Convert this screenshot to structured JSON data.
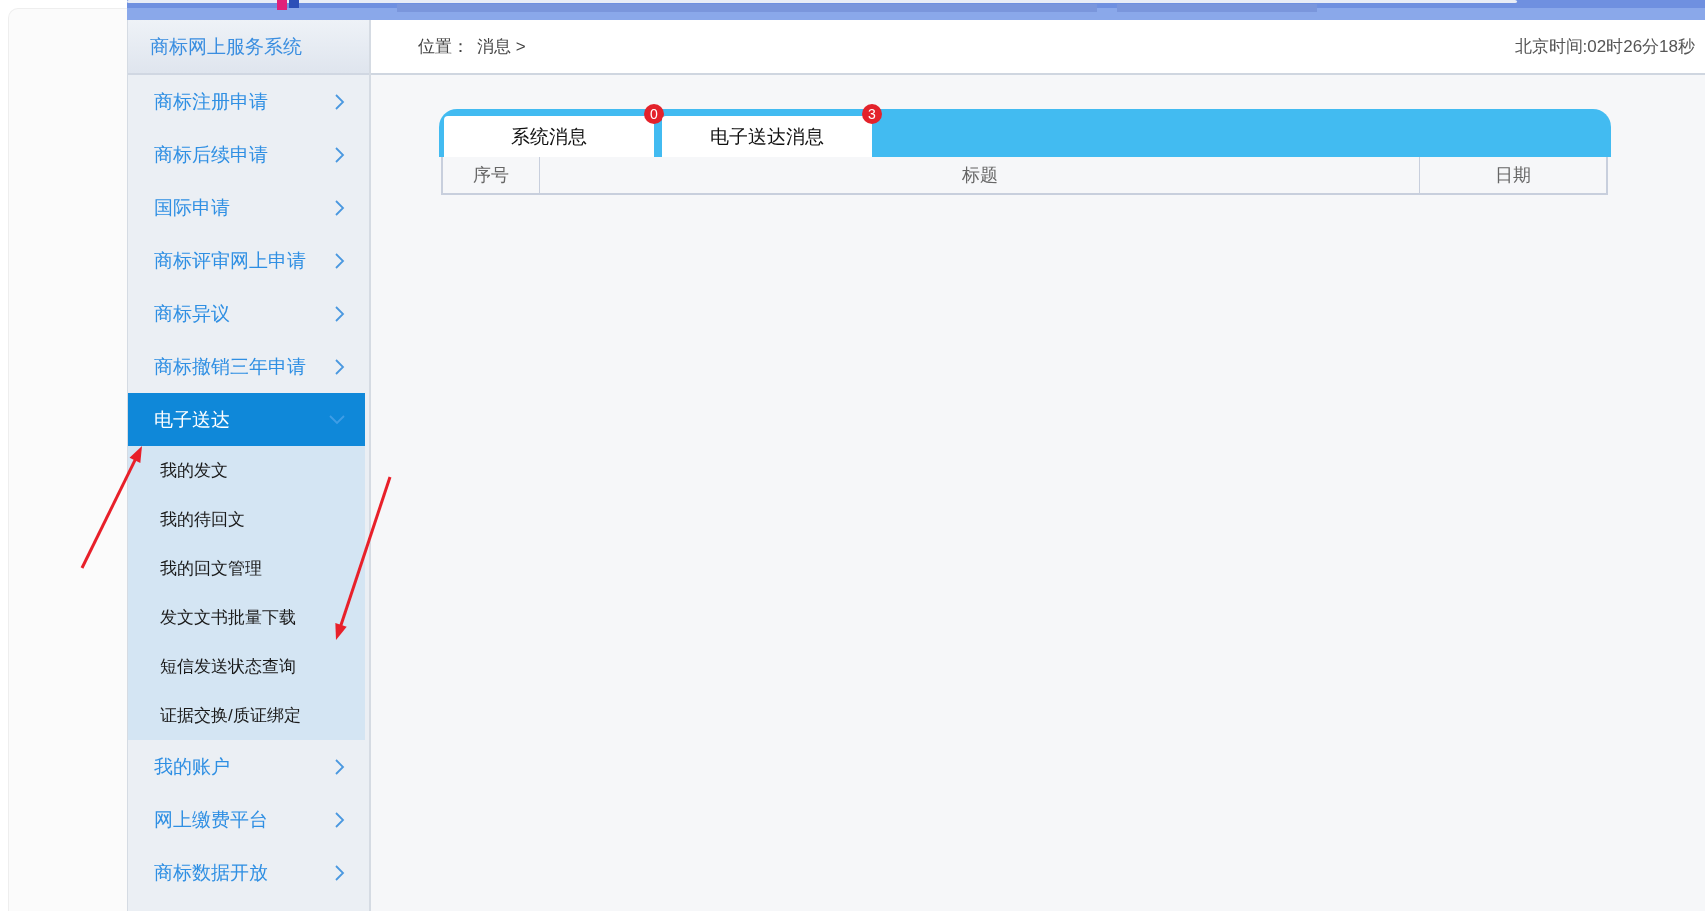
{
  "sidebar": {
    "title": "商标网上服务系统",
    "items": [
      {
        "label": "商标注册申请",
        "selected": false,
        "expanded": false
      },
      {
        "label": "商标后续申请",
        "selected": false,
        "expanded": false
      },
      {
        "label": "国际申请",
        "selected": false,
        "expanded": false
      },
      {
        "label": "商标评审网上申请",
        "selected": false,
        "expanded": false
      },
      {
        "label": "商标异议",
        "selected": false,
        "expanded": false
      },
      {
        "label": "商标撤销三年申请",
        "selected": false,
        "expanded": false
      },
      {
        "label": "电子送达",
        "selected": true,
        "expanded": true,
        "children": [
          {
            "label": "我的发文",
            "selected": false
          },
          {
            "label": "我的待回文",
            "selected": false
          },
          {
            "label": "我的回文管理",
            "selected": false
          },
          {
            "label": "发文文书批量下载",
            "selected": false
          },
          {
            "label": "短信发送状态查询",
            "selected": false
          },
          {
            "label": "证据交换/质证绑定",
            "selected": false
          }
        ]
      },
      {
        "label": "我的账户",
        "selected": false,
        "expanded": false
      },
      {
        "label": "网上缴费平台",
        "selected": false,
        "expanded": false
      },
      {
        "label": "商标数据开放",
        "selected": false,
        "expanded": false
      }
    ]
  },
  "breadcrumb": {
    "label": "位置：",
    "path": "消息 >"
  },
  "clock": "北京时间:02时26分18秒",
  "tabs": [
    {
      "label": "系统消息",
      "badge": "0",
      "selected": false
    },
    {
      "label": "电子送达消息",
      "badge": "3",
      "selected": false
    }
  ],
  "table": {
    "columns": [
      "序号",
      "标题",
      "日期"
    ]
  },
  "annotations": [
    {
      "kind": "arrow"
    },
    {
      "kind": "arrow"
    }
  ]
}
